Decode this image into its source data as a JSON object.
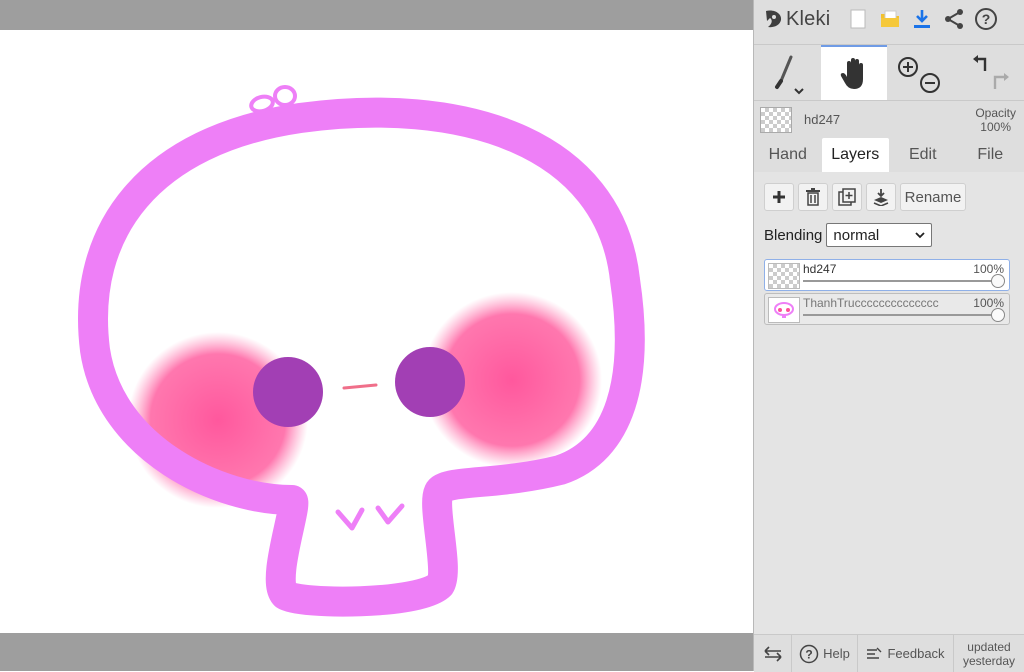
{
  "app": {
    "logo_text": "Kleki",
    "colors": {
      "accent": "#6f9be5",
      "download": "#1a73e8",
      "folder": "#f2c12e"
    }
  },
  "top_icons": [
    "new-image-icon",
    "open-folder-icon",
    "download-icon",
    "share-icon",
    "help-icon"
  ],
  "tools": [
    "brush-icon",
    "hand-icon",
    "zoom-in-icon",
    "zoom-out-icon",
    "undo-icon",
    "redo-icon"
  ],
  "current_layer": {
    "name": "hd247",
    "opacity_label": "Opacity",
    "opacity_value": "100%"
  },
  "tabs": [
    {
      "label": "Hand",
      "active": false
    },
    {
      "label": "Layers",
      "active": true
    },
    {
      "label": "Edit",
      "active": false
    },
    {
      "label": "File",
      "active": false
    }
  ],
  "layer_tools": {
    "rename_label": "Rename"
  },
  "blending": {
    "label": "Blending",
    "value": "normal"
  },
  "layers": [
    {
      "name": "hd247",
      "opacity": "100%",
      "opacity_fraction": 1.0,
      "selected": true
    },
    {
      "name": "ThanhTrucccccccccccccc",
      "opacity": "100%",
      "opacity_fraction": 1.0,
      "selected": false
    }
  ],
  "bottom": {
    "help": "Help",
    "feedback": "Feedback",
    "updated_line1": "updated",
    "updated_line2": "yesterday"
  },
  "drawing": {
    "colors": {
      "outline": "#ee7ff7",
      "blush": "#ff4f98",
      "eyes": "#a23fb4",
      "mouth": "#f06f8a"
    }
  }
}
